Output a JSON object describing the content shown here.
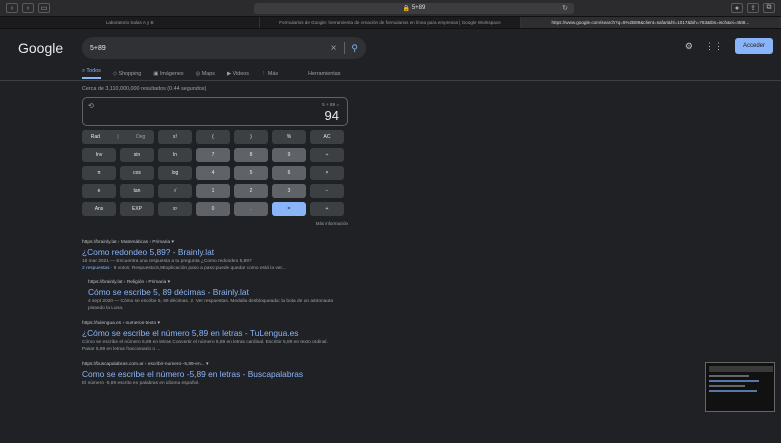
{
  "browser": {
    "url_text": "5+89",
    "tabs": [
      {
        "label": "Laboratorio Salas A y B",
        "active": false
      },
      {
        "label": "Formularios de Google: herramienta de creación de formularios en línea para empresas | Google Workspace",
        "active": false
      },
      {
        "label": "https://www.google.com/search?q=5%2B89&client=safari&hl=1017&bih=763&tbs=isch&ei=45t8...",
        "active": true
      }
    ]
  },
  "header": {
    "logo": "Google",
    "query": "5+89",
    "signin_label": "Acceder"
  },
  "nav": {
    "tabs": [
      {
        "label": "Todos",
        "active": true,
        "icon": "search-icon"
      },
      {
        "label": "Shopping",
        "active": false,
        "icon": "tag-icon"
      },
      {
        "label": "Imágenes",
        "active": false,
        "icon": "image-icon"
      },
      {
        "label": "Maps",
        "active": false,
        "icon": "map-pin-icon"
      },
      {
        "label": "Videos",
        "active": false,
        "icon": "video-icon"
      },
      {
        "label": "Más",
        "active": false,
        "icon": "more-icon"
      }
    ],
    "tools_label": "Herramientas"
  },
  "stats": "Cerca de 3,110,000,000 resultados (0.44 segundos)",
  "calculator": {
    "expression": "5 + 89 =",
    "result": "94",
    "keys": [
      [
        "Rad | Deg",
        "x!",
        "(",
        ")",
        "%",
        "AC"
      ],
      [
        "Inv",
        "sin",
        "ln",
        "7",
        "8",
        "9",
        "÷"
      ],
      [
        "π",
        "cos",
        "log",
        "4",
        "5",
        "6",
        "×"
      ],
      [
        "e",
        "tan",
        "√",
        "1",
        "2",
        "3",
        "−"
      ],
      [
        "Ans",
        "EXP",
        "xʸ",
        "0",
        ".",
        "=",
        "+"
      ]
    ],
    "more_info": "Más información"
  },
  "results": [
    {
      "sub": false,
      "url": "https://brainly.lat › Matemáticas › Primaria",
      "title": "¿Como redondeo 5,89? - Brainly.lat",
      "snippet": "18 mar 2021 — Encuentra una respuesta a tu pregunta ¿Como redondeo 5,89?",
      "extra_link": "2 respuestas",
      "extra_text": " · 8 votos: Respuesta:5,9Explicación paso a paso:puede quedar como está la ver..."
    },
    {
      "sub": true,
      "url": "https://brainly.lat › Religión › Primaria",
      "title": "Cómo se escribe 5, 89 décimas - Brainly.lat",
      "snippet": "4 sept 2020 — Cómo se escribe 5, 89 décimas. 2. Ver respuestas. Medalla desbloqueada: la bota de un astronauta pisando la Luna.",
      "extra_link": "",
      "extra_text": ""
    },
    {
      "sub": false,
      "url": "https://tulengua.es › numeros-texto",
      "title": "¿Cómo se escribe el número 5,89 en letras - TuLengua.es",
      "snippet": "Cómo se escribe el número 5,89 en letras Convertir el número 5,89 en letras cardinal. Escribir 5,89 en texto ordinal. Pasar 5,89 en letras fraccionario o ...",
      "extra_link": "",
      "extra_text": ""
    },
    {
      "sub": false,
      "url": "https://buscapalabras.com.ar › escribir-numero--5,89-en...",
      "title": "Como se escribe el número -5,89 en letras - Buscapalabras",
      "snippet": "El número -5,89 escrito en palabras en idioma español.",
      "extra_link": "",
      "extra_text": ""
    }
  ]
}
